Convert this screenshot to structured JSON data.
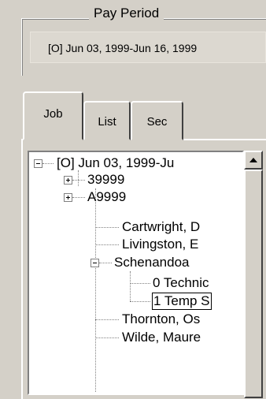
{
  "pay_period": {
    "legend": "Pay Period",
    "value": "[O] Jun 03, 1999-Jun 16, 1999"
  },
  "tabs": [
    {
      "label": "Job",
      "active": true
    },
    {
      "label": "List",
      "active": false
    },
    {
      "label": "Sec",
      "active": false
    }
  ],
  "tree": {
    "root": "[O] Jun 03, 1999-Ju",
    "nodes": [
      {
        "label": "39999",
        "expander": "plus"
      },
      {
        "label": "A9999",
        "expander": "plus"
      },
      {
        "label": "Cartwright, D"
      },
      {
        "label": "Livingston, E"
      },
      {
        "label": "Schenandoa",
        "expander": "minus"
      },
      {
        "label": "0 Technic"
      },
      {
        "label": "1 Temp S",
        "selected": true
      },
      {
        "label": "Thornton, Os"
      },
      {
        "label": "Wilde, Maure"
      }
    ]
  }
}
